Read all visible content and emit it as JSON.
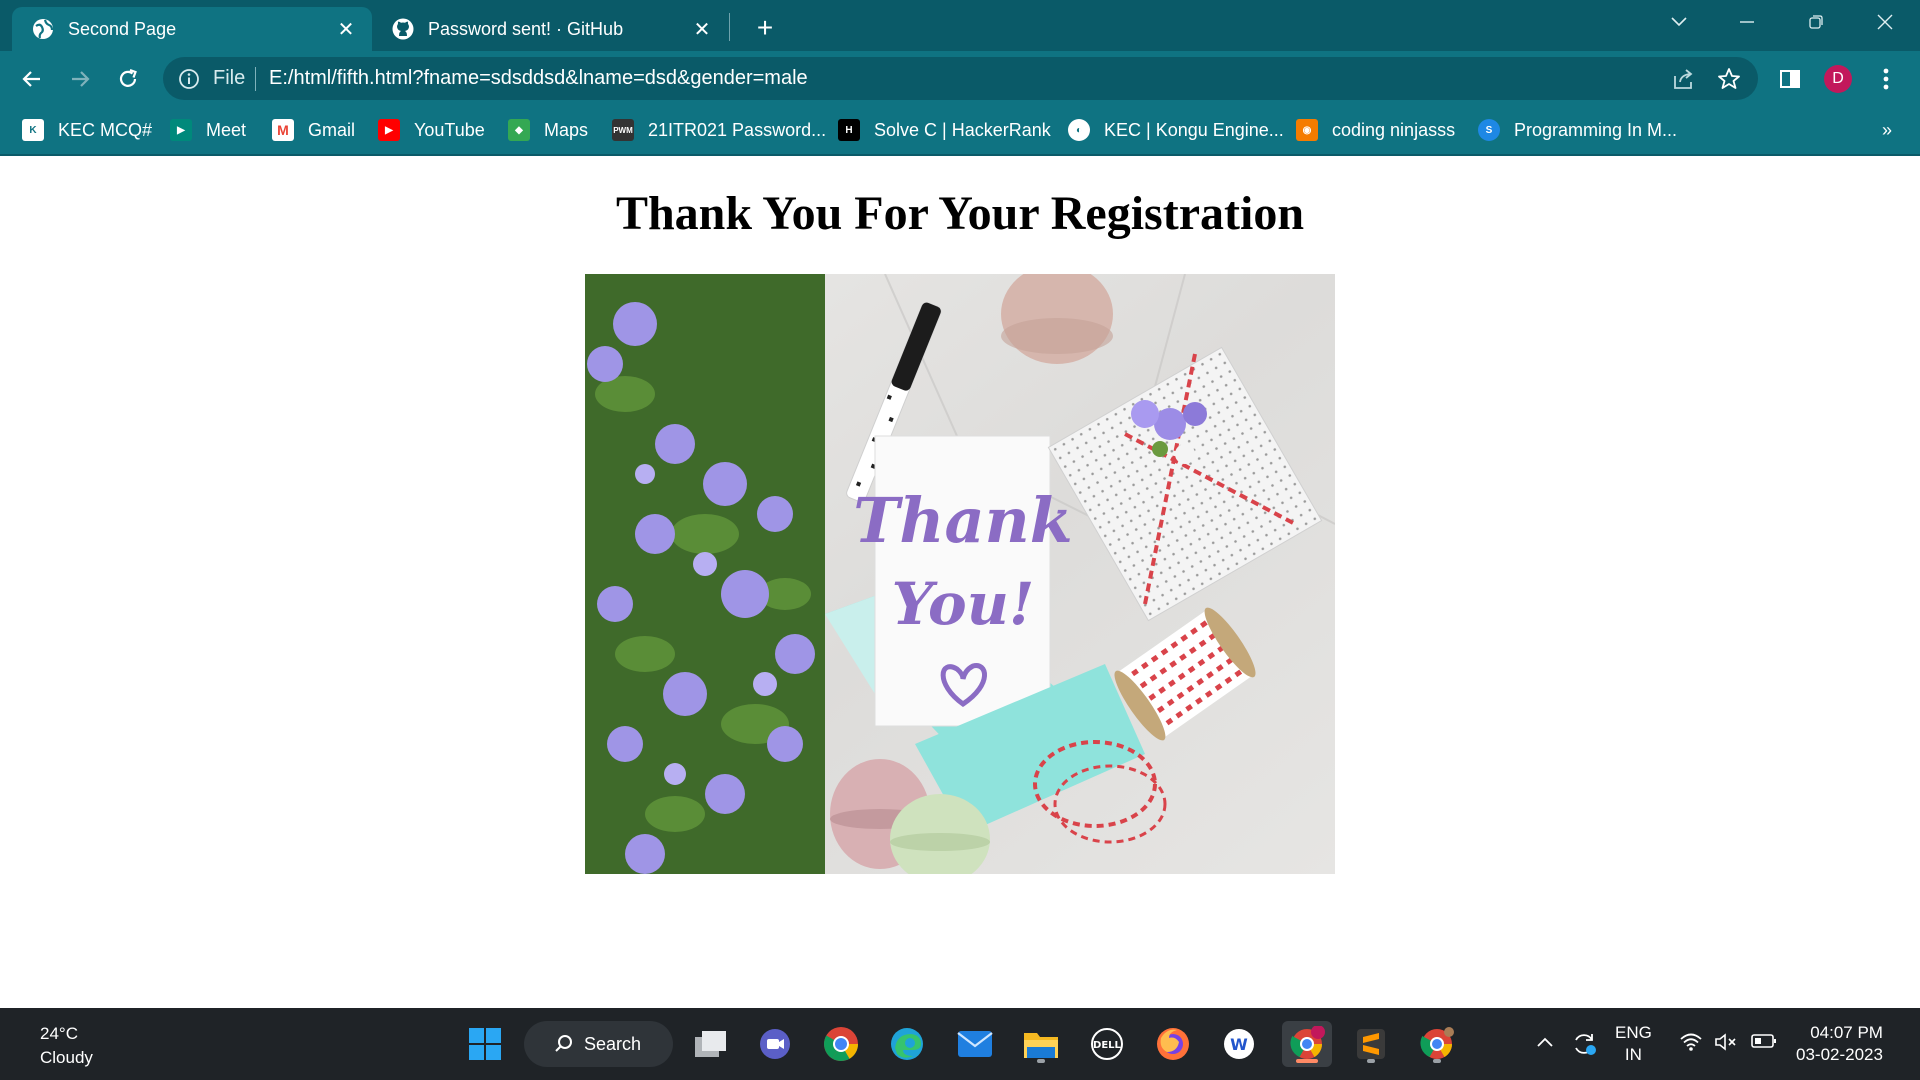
{
  "browser": {
    "tabs": [
      {
        "title": "Second Page",
        "active": true,
        "icon": "globe-icon"
      },
      {
        "title": "Password sent! · GitHub",
        "active": false,
        "icon": "github-icon"
      }
    ],
    "omnibox": {
      "scheme_label": "File",
      "url": "E:/html/fifth.html?fname=sdsddsd&lname=dsd&gender=male"
    },
    "profile_initial": "D",
    "bookmarks": [
      {
        "label": "KEC MCQ#",
        "icon": "kec-icon",
        "color": "#ffffff"
      },
      {
        "label": "Meet",
        "icon": "meet-icon",
        "color": "#00897b"
      },
      {
        "label": "Gmail",
        "icon": "gmail-icon",
        "color": "#ea4335"
      },
      {
        "label": "YouTube",
        "icon": "youtube-icon",
        "color": "#ff0000"
      },
      {
        "label": "Maps",
        "icon": "maps-icon",
        "color": "#34a853"
      },
      {
        "label": "21ITR021 Password...",
        "icon": "pwm-icon",
        "color": "#333333"
      },
      {
        "label": "Solve C | HackerRank",
        "icon": "hackerrank-icon",
        "color": "#000000"
      },
      {
        "label": "KEC | Kongu Engine...",
        "icon": "globe-icon",
        "color": "#ffffff"
      },
      {
        "label": "coding ninjasss",
        "icon": "codingninjas-icon",
        "color": "#f57c00"
      },
      {
        "label": "Programming In M...",
        "icon": "programming-icon",
        "color": "#1e88e5"
      }
    ],
    "more_bookmarks": "»"
  },
  "page": {
    "heading": "Thank You For Your Registration",
    "card_text_line1": "Thank",
    "card_text_line2": "You!"
  },
  "taskbar": {
    "weather_temp": "24°C",
    "weather_desc": "Cloudy",
    "search_label": "Search",
    "language_top": "ENG",
    "language_bottom": "IN",
    "time": "04:07 PM",
    "date": "03-02-2023",
    "chrome_badge": "D"
  }
}
